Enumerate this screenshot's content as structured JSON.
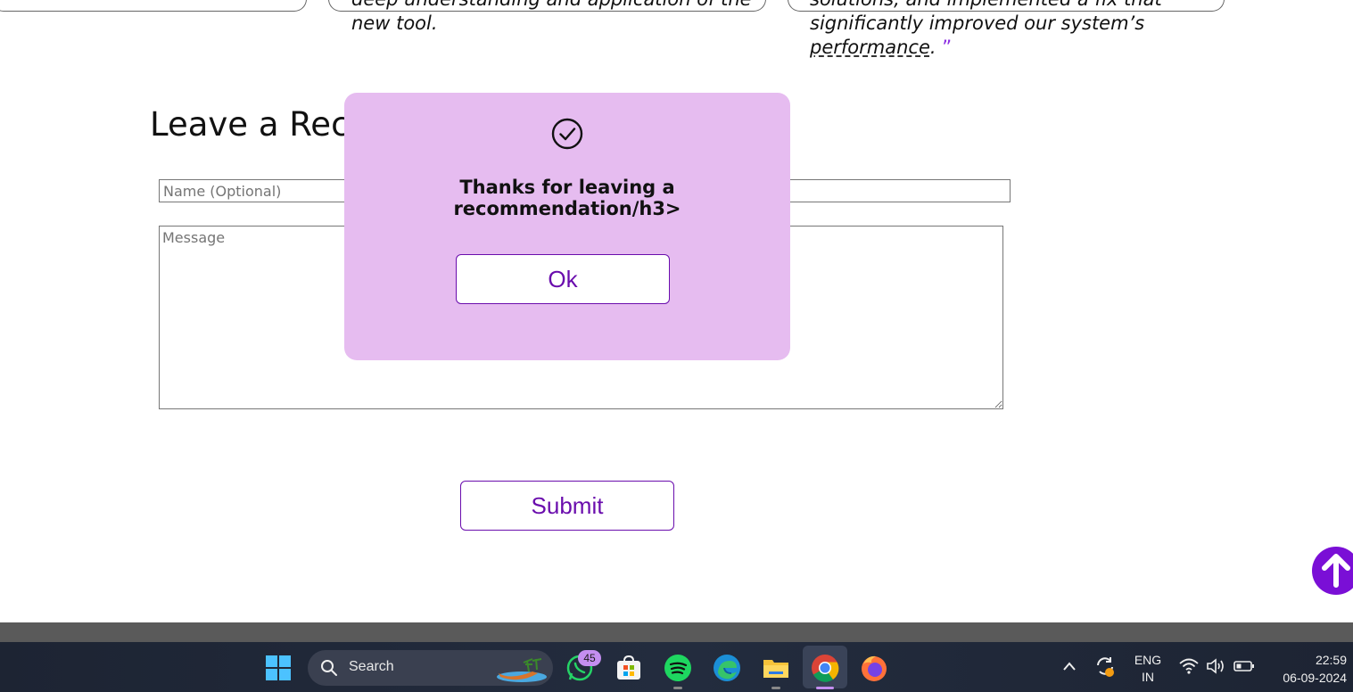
{
  "testimonials": [
    {
      "line1": "deep understanding and application of the",
      "line2": "new tool."
    },
    {
      "line1": "solutions, and implemented a fix that",
      "line2": "significantly improved our system’s",
      "line3": "performance",
      "end": ". ",
      "quote_close": "”"
    }
  ],
  "form": {
    "title": "Leave a Recommendation",
    "name_placeholder": "Name (Optional)",
    "message_placeholder": "Message",
    "submit_label": "Submit"
  },
  "modal": {
    "icon": "check-circle-icon",
    "message": "Thanks for leaving a recommendation/h3>",
    "ok_label": "Ok"
  },
  "scroll_top": {
    "icon": "arrow-up-icon"
  },
  "colors": {
    "accent": "#6a0dad",
    "modal_bg": "#e6bcf0",
    "scroll_btn": "#7a0fd6"
  },
  "taskbar": {
    "search_label": "Search",
    "whatsapp_badge": "45",
    "apps": [
      "windows-start-icon",
      "whatsapp-icon",
      "microsoft-store-icon",
      "spotify-icon",
      "edge-icon",
      "file-explorer-icon",
      "chrome-icon",
      "firefox-icon"
    ],
    "lang_top": "ENG",
    "lang_bottom": "IN",
    "time": "22:59",
    "date": "06-09-2024"
  }
}
